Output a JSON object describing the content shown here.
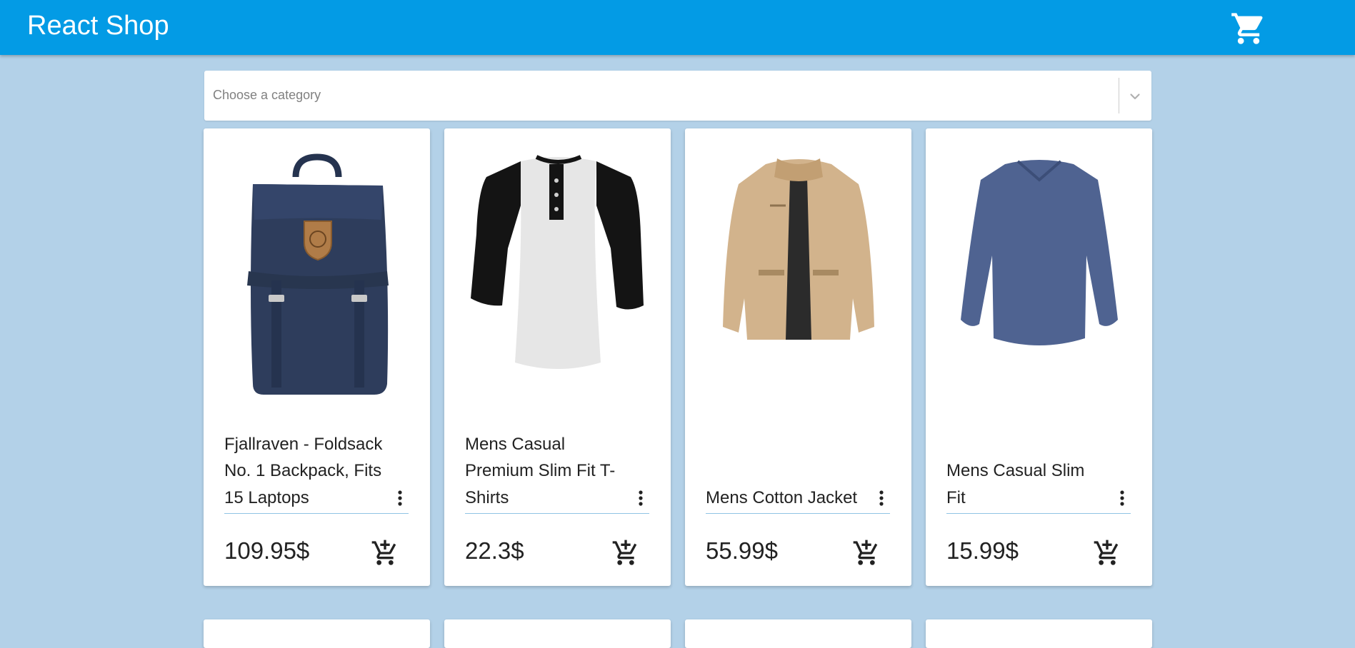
{
  "app": {
    "title": "React Shop",
    "cart_icon": "shopping-cart-icon",
    "brand_color": "#039be5",
    "background_color": "#b3d1e8"
  },
  "filter": {
    "placeholder": "Choose a category",
    "dropdown_icon": "chevron-down-icon"
  },
  "products": [
    {
      "title": "Fjallraven - Foldsack No. 1 Backpack, Fits 15 Laptops",
      "price": "109.95$",
      "image": "backpack-image"
    },
    {
      "title": "Mens Casual Premium Slim Fit T-Shirts",
      "price": "22.3$",
      "image": "tshirt-image"
    },
    {
      "title": "Mens Cotton Jacket",
      "price": "55.99$",
      "image": "jacket-image"
    },
    {
      "title": "Mens Casual Slim Fit",
      "price": "15.99$",
      "image": "long-sleeve-shirt-image"
    }
  ],
  "card_actions": {
    "more_icon": "more-vert-icon",
    "add_to_cart_icon": "add-shopping-cart-icon"
  }
}
